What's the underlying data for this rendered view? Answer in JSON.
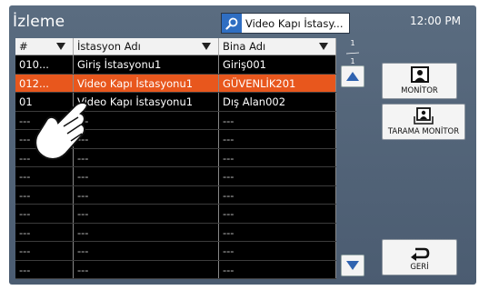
{
  "header": {
    "title": "İzleme",
    "clock": "12:00 PM"
  },
  "search": {
    "value": "Video Kapı İstasy..."
  },
  "table": {
    "columns": [
      {
        "label": "#"
      },
      {
        "label": "İstasyon Adı"
      },
      {
        "label": "Bina Adı"
      }
    ],
    "rows": [
      {
        "num": "010...",
        "station": "Giriş İstasyonu1",
        "building": "Giriş001",
        "selected": false
      },
      {
        "num": "012...",
        "station": "Video Kapı İstasyonu1",
        "building": "GÜVENLİK201",
        "selected": true
      },
      {
        "num": "01",
        "station": "Video Kapı İstasyonu1",
        "building": "Dış Alan002",
        "selected": false
      },
      {
        "num": "---",
        "station": "---",
        "building": "---"
      },
      {
        "num": "---",
        "station": "---",
        "building": "---"
      },
      {
        "num": "---",
        "station": "---",
        "building": "---"
      },
      {
        "num": "---",
        "station": "---",
        "building": "---"
      },
      {
        "num": "---",
        "station": "---",
        "building": "---"
      },
      {
        "num": "---",
        "station": "---",
        "building": "---"
      },
      {
        "num": "---",
        "station": "---",
        "building": "---"
      },
      {
        "num": "---",
        "station": "---",
        "building": "---"
      },
      {
        "num": "---",
        "station": "---",
        "building": "---"
      }
    ]
  },
  "pagination": {
    "current": "1",
    "total": "1"
  },
  "buttons": {
    "monitor": {
      "label": "MONİTOR",
      "icon": "monitor-person-icon"
    },
    "tarama": {
      "label": "TARAMA MONİTOR",
      "icon": "scan-monitor-icon"
    },
    "geri": {
      "label": "GERİ",
      "icon": "back-arrow-icon"
    }
  },
  "colors": {
    "background": "#52657a",
    "selected_row": "#e8571d",
    "search_icon_bg": "#2f6ec2",
    "table_bg": "#000000"
  }
}
